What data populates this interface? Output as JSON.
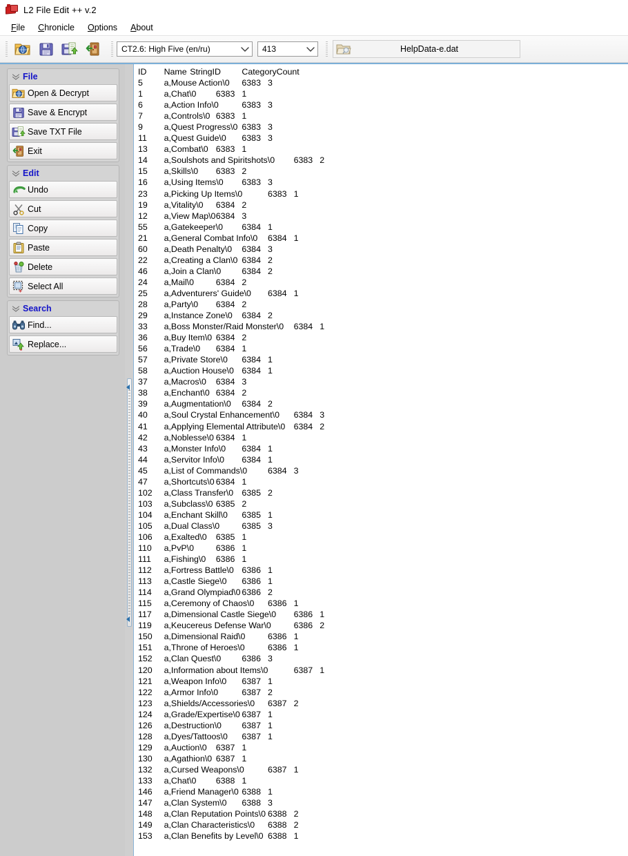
{
  "window": {
    "title": "L2 File Edit ++ v.2",
    "icon": "app-icon"
  },
  "menubar": [
    {
      "label": "File",
      "accel": "F"
    },
    {
      "label": "Chronicle",
      "accel": "C"
    },
    {
      "label": "Options",
      "accel": "O"
    },
    {
      "label": "About",
      "accel": "A"
    }
  ],
  "toolbar": {
    "buttons": [
      {
        "name": "open-decrypt-icon",
        "tooltip": "Open & Decrypt"
      },
      {
        "name": "save-encrypt-icon",
        "tooltip": "Save & Encrypt"
      },
      {
        "name": "save-txt-icon",
        "tooltip": "Save TXT File"
      },
      {
        "name": "exit-icon",
        "tooltip": "Exit"
      }
    ],
    "chronicle_select": {
      "value": "CT2.6: High Five (en/ru)",
      "options": [
        "CT2.6: High Five (en/ru)"
      ]
    },
    "count_select": {
      "value": "413",
      "options": [
        "413"
      ]
    },
    "file_field": {
      "filename": "HelpData-e.dat",
      "icon": "file-folder-icon"
    }
  },
  "sidebar": {
    "groups": [
      {
        "title": "File",
        "items": [
          {
            "label": "Open & Decrypt",
            "icon": "open-folder-icon"
          },
          {
            "label": "Save & Encrypt",
            "icon": "floppy-disk-icon"
          },
          {
            "label": "Save TXT File",
            "icon": "save-text-icon"
          },
          {
            "label": "Exit",
            "icon": "exit-door-icon"
          }
        ]
      },
      {
        "title": "Edit",
        "items": [
          {
            "label": "Undo",
            "icon": "undo-arrow-icon"
          },
          {
            "label": "Cut",
            "icon": "scissors-icon"
          },
          {
            "label": "Copy",
            "icon": "copy-pages-icon"
          },
          {
            "label": "Paste",
            "icon": "clipboard-icon"
          },
          {
            "label": "Delete",
            "icon": "delete-icon"
          },
          {
            "label": "Select All",
            "icon": "select-all-icon"
          }
        ]
      },
      {
        "title": "Search",
        "items": [
          {
            "label": "Find...",
            "icon": "binoculars-icon"
          },
          {
            "label": "Replace...",
            "icon": "replace-icon"
          }
        ]
      }
    ]
  },
  "editor": {
    "header": [
      "ID",
      "Name",
      "StringID",
      "CategoryCount"
    ],
    "header_raw": "ID\tName\tStringID\tCategoryCount",
    "rows": [
      {
        "id": "5",
        "name": "a,Mouse Action\\0",
        "stringid": "6383",
        "count": "3"
      },
      {
        "id": "1",
        "name": "a,Chat\\0",
        "stringid": "6383",
        "count": "1"
      },
      {
        "id": "6",
        "name": "a,Action Info\\0",
        "stringid": "6383",
        "count": "3"
      },
      {
        "id": "7",
        "name": "a,Controls\\0",
        "stringid": "6383",
        "count": "1"
      },
      {
        "id": "9",
        "name": "a,Quest Progress\\0",
        "stringid": "6383",
        "count": "3"
      },
      {
        "id": "11",
        "name": "a,Quest Guide\\0",
        "stringid": "6383",
        "count": "3"
      },
      {
        "id": "13",
        "name": "a,Combat\\0",
        "stringid": "6383",
        "count": "1"
      },
      {
        "id": "14",
        "name": "a,Soulshots and Spiritshots\\0",
        "stringid": "6383",
        "count": "2"
      },
      {
        "id": "15",
        "name": "a,Skills\\0",
        "stringid": "6383",
        "count": "2"
      },
      {
        "id": "16",
        "name": "a,Using Items\\0",
        "stringid": "6383",
        "count": "3"
      },
      {
        "id": "23",
        "name": "a,Picking Up Items\\0",
        "stringid": "6383",
        "count": "1"
      },
      {
        "id": "19",
        "name": "a,Vitality\\0",
        "stringid": "6384",
        "count": "2"
      },
      {
        "id": "12",
        "name": "a,View Map\\0",
        "stringid": "6384",
        "count": "3"
      },
      {
        "id": "55",
        "name": "a,Gatekeeper\\0",
        "stringid": "6384",
        "count": "1"
      },
      {
        "id": "21",
        "name": "a,General Combat Info\\0",
        "stringid": "6384",
        "count": "1"
      },
      {
        "id": "60",
        "name": "a,Death Penalty\\0",
        "stringid": "6384",
        "count": "3"
      },
      {
        "id": "22",
        "name": "a,Creating a Clan\\0",
        "stringid": "6384",
        "count": "2"
      },
      {
        "id": "46",
        "name": "a,Join a Clan\\0",
        "stringid": "6384",
        "count": "2"
      },
      {
        "id": "24",
        "name": "a,Mail\\0",
        "stringid": "6384",
        "count": "2"
      },
      {
        "id": "25",
        "name": "a,Adventurers' Guide\\0",
        "stringid": "6384",
        "count": "1"
      },
      {
        "id": "28",
        "name": "a,Party\\0",
        "stringid": "6384",
        "count": "2"
      },
      {
        "id": "29",
        "name": "a,Instance Zone\\0",
        "stringid": "6384",
        "count": "2"
      },
      {
        "id": "33",
        "name": "a,Boss Monster/Raid Monster\\0",
        "stringid": "6384",
        "count": "1"
      },
      {
        "id": "36",
        "name": "a,Buy Item\\0",
        "stringid": "6384",
        "count": "2"
      },
      {
        "id": "56",
        "name": "a,Trade\\0",
        "stringid": "6384",
        "count": "1"
      },
      {
        "id": "57",
        "name": "a,Private Store\\0",
        "stringid": "6384",
        "count": "1"
      },
      {
        "id": "58",
        "name": "a,Auction House\\0",
        "stringid": "6384",
        "count": "1"
      },
      {
        "id": "37",
        "name": "a,Macros\\0",
        "stringid": "6384",
        "count": "3"
      },
      {
        "id": "38",
        "name": "a,Enchant\\0",
        "stringid": "6384",
        "count": "2"
      },
      {
        "id": "39",
        "name": "a,Augmentation\\0",
        "stringid": "6384",
        "count": "2"
      },
      {
        "id": "40",
        "name": "a,Soul Crystal Enhancement\\0",
        "stringid": "6384",
        "count": "3"
      },
      {
        "id": "41",
        "name": "a,Applying Elemental Attribute\\0",
        "stringid": "6384",
        "count": "2"
      },
      {
        "id": "42",
        "name": "a,Noblesse\\0",
        "stringid": "6384",
        "count": "1"
      },
      {
        "id": "43",
        "name": "a,Monster Info\\0",
        "stringid": "6384",
        "count": "1"
      },
      {
        "id": "44",
        "name": "a,Servitor Info\\0",
        "stringid": "6384",
        "count": "1"
      },
      {
        "id": "45",
        "name": "a,List of Commands\\0",
        "stringid": "6384",
        "count": "3"
      },
      {
        "id": "47",
        "name": "a,Shortcuts\\0",
        "stringid": "6384",
        "count": "1"
      },
      {
        "id": "102",
        "name": "a,Class Transfer\\0",
        "stringid": "6385",
        "count": "2"
      },
      {
        "id": "103",
        "name": "a,Subclass\\0",
        "stringid": "6385",
        "count": "2"
      },
      {
        "id": "104",
        "name": "a,Enchant Skill\\0",
        "stringid": "6385",
        "count": "1"
      },
      {
        "id": "105",
        "name": "a,Dual Class\\0",
        "stringid": "6385",
        "count": "3"
      },
      {
        "id": "106",
        "name": "a,Exalted\\0",
        "stringid": "6385",
        "count": "1"
      },
      {
        "id": "110",
        "name": "a,PvP\\0",
        "stringid": "6386",
        "count": "1"
      },
      {
        "id": "111",
        "name": "a,Fishing\\0",
        "stringid": "6386",
        "count": "1"
      },
      {
        "id": "112",
        "name": "a,Fortress Battle\\0",
        "stringid": "6386",
        "count": "1"
      },
      {
        "id": "113",
        "name": "a,Castle Siege\\0",
        "stringid": "6386",
        "count": "1"
      },
      {
        "id": "114",
        "name": "a,Grand Olympiad\\0",
        "stringid": "6386",
        "count": "2"
      },
      {
        "id": "115",
        "name": "a,Ceremony of Chaos\\0",
        "stringid": "6386",
        "count": "1"
      },
      {
        "id": "117",
        "name": "a,Dimensional Castle Siege\\0",
        "stringid": "6386",
        "count": "1"
      },
      {
        "id": "119",
        "name": "a,Keucereus Defense War\\0",
        "stringid": "6386",
        "count": "2"
      },
      {
        "id": "150",
        "name": "a,Dimensional Raid\\0",
        "stringid": "6386",
        "count": "1"
      },
      {
        "id": "151",
        "name": "a,Throne of Heroes\\0",
        "stringid": "6386",
        "count": "1"
      },
      {
        "id": "152",
        "name": "a,Clan Quest\\0",
        "stringid": "6386",
        "count": "3"
      },
      {
        "id": "120",
        "name": "a,Information about Items\\0",
        "stringid": "6387",
        "count": "1"
      },
      {
        "id": "121",
        "name": "a,Weapon Info\\0",
        "stringid": "6387",
        "count": "1"
      },
      {
        "id": "122",
        "name": "a,Armor Info\\0",
        "stringid": "6387",
        "count": "2"
      },
      {
        "id": "123",
        "name": "a,Shields/Accessories\\0",
        "stringid": "6387",
        "count": "2"
      },
      {
        "id": "124",
        "name": "a,Grade/Expertise\\0",
        "stringid": "6387",
        "count": "1"
      },
      {
        "id": "126",
        "name": "a,Destruction\\0",
        "stringid": "6387",
        "count": "1"
      },
      {
        "id": "128",
        "name": "a,Dyes/Tattoos\\0",
        "stringid": "6387",
        "count": "1"
      },
      {
        "id": "129",
        "name": "a,Auction\\0",
        "stringid": "6387",
        "count": "1"
      },
      {
        "id": "130",
        "name": "a,Agathion\\0",
        "stringid": "6387",
        "count": "1"
      },
      {
        "id": "132",
        "name": "a,Cursed Weapons\\0",
        "stringid": "6387",
        "count": "1"
      },
      {
        "id": "133",
        "name": "a,Chat\\0",
        "stringid": "6388",
        "count": "1"
      },
      {
        "id": "146",
        "name": "a,Friend Manager\\0",
        "stringid": "6388",
        "count": "1"
      },
      {
        "id": "147",
        "name": "a,Clan System\\0",
        "stringid": "6388",
        "count": "3"
      },
      {
        "id": "148",
        "name": "a,Clan Reputation Points\\0",
        "stringid": "6388",
        "count": "2"
      },
      {
        "id": "149",
        "name": "a,Clan Characteristics\\0",
        "stringid": "6388",
        "count": "2"
      },
      {
        "id": "153",
        "name": "a,Clan Benefits by Level\\0",
        "stringid": "6388",
        "count": "1"
      }
    ]
  },
  "colors": {
    "group_title": "#1414c8",
    "splitter_accent": "#7bafd8",
    "pane_background": "#ffffff",
    "sidebar_background": "#cccccc"
  }
}
